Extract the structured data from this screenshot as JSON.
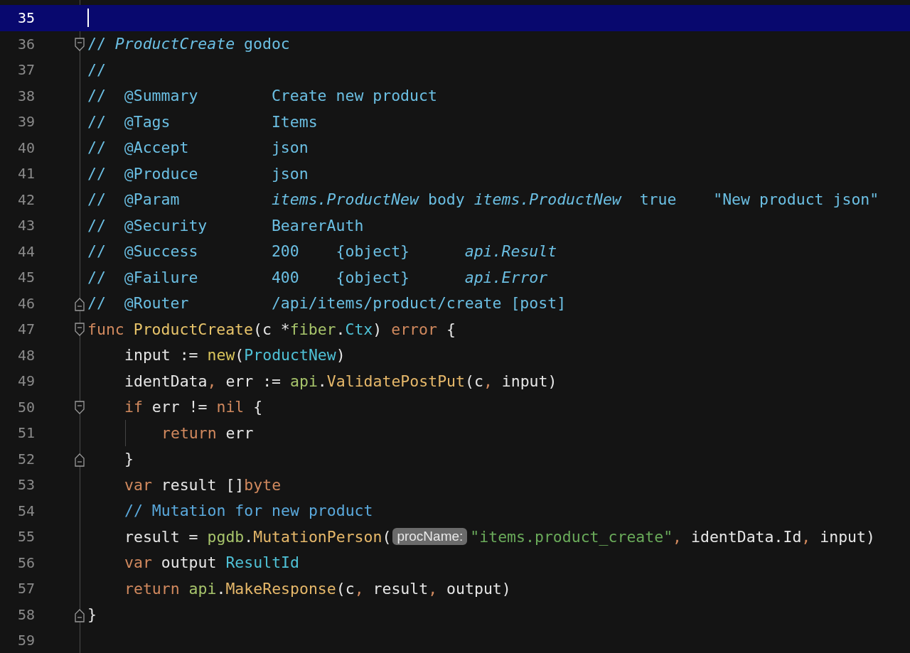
{
  "editor": {
    "lines": [
      {
        "number": "35",
        "selected": true
      },
      {
        "number": "36",
        "selected": false,
        "fold_start": true,
        "fold_end": false,
        "tokens": [
          {
            "text": "// ",
            "kind": "doc"
          },
          {
            "text": "ProductCreate",
            "kind": "doc_ref"
          },
          {
            "text": " godoc",
            "kind": "doc"
          }
        ]
      },
      {
        "number": "37",
        "selected": false,
        "tokens": [
          {
            "text": "//",
            "kind": "doc"
          }
        ]
      },
      {
        "number": "38",
        "selected": false,
        "tokens": [
          {
            "text": "//  @Summary        Create new product",
            "kind": "doc"
          }
        ]
      },
      {
        "number": "39",
        "selected": false,
        "tokens": [
          {
            "text": "//  @Tags           Items",
            "kind": "doc"
          }
        ]
      },
      {
        "number": "40",
        "selected": false,
        "tokens": [
          {
            "text": "//  @Accept         json",
            "kind": "doc"
          }
        ]
      },
      {
        "number": "41",
        "selected": false,
        "tokens": [
          {
            "text": "//  @Produce        json",
            "kind": "doc"
          }
        ]
      },
      {
        "number": "42",
        "selected": false,
        "tokens": [
          {
            "text": "//  @Param          ",
            "kind": "doc"
          },
          {
            "text": "items.ProductNew",
            "kind": "doc_ref"
          },
          {
            "text": " body ",
            "kind": "doc"
          },
          {
            "text": "items.ProductNew",
            "kind": "doc_ref"
          },
          {
            "text": "  true    \"New product json\"",
            "kind": "doc"
          }
        ]
      },
      {
        "number": "43",
        "selected": false,
        "tokens": [
          {
            "text": "//  @Security       BearerAuth",
            "kind": "doc"
          }
        ]
      },
      {
        "number": "44",
        "selected": false,
        "tokens": [
          {
            "text": "//  @Success        200    {object}      ",
            "kind": "doc"
          },
          {
            "text": "api.Result",
            "kind": "doc_ref"
          }
        ]
      },
      {
        "number": "45",
        "selected": false,
        "tokens": [
          {
            "text": "//  @Failure        400    {object}      ",
            "kind": "doc"
          },
          {
            "text": "api.Error",
            "kind": "doc_ref"
          }
        ]
      },
      {
        "number": "46",
        "selected": false,
        "fold_start": false,
        "fold_end": true,
        "tokens": [
          {
            "text": "//  @Router         /api/items/product/create [post]",
            "kind": "doc"
          }
        ]
      },
      {
        "number": "47",
        "selected": false,
        "fold_start": true,
        "fold_end": false,
        "tokens": [
          {
            "text": "func ",
            "kind": "keyword"
          },
          {
            "text": "ProductCreate",
            "kind": "function"
          },
          {
            "text": "(c *",
            "kind": "plain"
          },
          {
            "text": "fiber",
            "kind": "package"
          },
          {
            "text": ".",
            "kind": "plain"
          },
          {
            "text": "Ctx",
            "kind": "type"
          },
          {
            "text": ") ",
            "kind": "plain"
          },
          {
            "text": "error",
            "kind": "keyword"
          },
          {
            "text": " {",
            "kind": "plain"
          }
        ],
        "children": [
          {
            "number": "48",
            "selected": false,
            "tokens": [
              {
                "text": "input := ",
                "kind": "plain"
              },
              {
                "text": "new",
                "kind": "builtin"
              },
              {
                "text": "(",
                "kind": "plain"
              },
              {
                "text": "ProductNew",
                "kind": "type"
              },
              {
                "text": ")",
                "kind": "plain"
              }
            ]
          },
          {
            "number": "49",
            "selected": false,
            "tokens": [
              {
                "text": "identData",
                "kind": "plain"
              },
              {
                "text": ",",
                "kind": "keyword"
              },
              {
                "text": " err := ",
                "kind": "plain"
              },
              {
                "text": "api",
                "kind": "package"
              },
              {
                "text": ".",
                "kind": "plain"
              },
              {
                "text": "ValidatePostPut",
                "kind": "call"
              },
              {
                "text": "(c",
                "kind": "plain"
              },
              {
                "text": ",",
                "kind": "keyword"
              },
              {
                "text": " input)",
                "kind": "plain"
              }
            ]
          },
          {
            "number": "50",
            "selected": false,
            "fold_start": true,
            "fold_end": false,
            "tokens": [
              {
                "text": "if",
                "kind": "keyword"
              },
              {
                "text": " err != ",
                "kind": "plain"
              },
              {
                "text": "nil",
                "kind": "keyword"
              },
              {
                "text": " {",
                "kind": "plain"
              }
            ],
            "children": [
              {
                "number": "51",
                "selected": false,
                "tokens": [
                  {
                    "text": "return",
                    "kind": "keyword"
                  },
                  {
                    "text": " err",
                    "kind": "plain"
                  }
                ]
              }
            ]
          },
          {
            "number": "52",
            "selected": false,
            "fold_start": false,
            "fold_end": true,
            "tokens": [
              {
                "text": "}",
                "kind": "plain"
              }
            ]
          },
          {
            "number": "53",
            "selected": false,
            "tokens": [
              {
                "text": "var",
                "kind": "keyword"
              },
              {
                "text": " result []",
                "kind": "plain"
              },
              {
                "text": "byte",
                "kind": "keyword"
              }
            ]
          },
          {
            "number": "54",
            "selected": false,
            "tokens": [
              {
                "text": "// Mutation for new product",
                "kind": "comment"
              }
            ]
          },
          {
            "number": "55",
            "selected": false,
            "tokens": [
              {
                "text": "result = ",
                "kind": "plain"
              },
              {
                "text": "pgdb",
                "kind": "package"
              },
              {
                "text": ".",
                "kind": "plain"
              },
              {
                "text": "MutationPerson",
                "kind": "call"
              },
              {
                "text": "(",
                "kind": "plain"
              },
              {
                "text": "procName:",
                "kind": "hint"
              },
              {
                "text": "\"items.product_create\"",
                "kind": "string"
              },
              {
                "text": ",",
                "kind": "keyword"
              },
              {
                "text": " identData.Id",
                "kind": "plain"
              },
              {
                "text": ",",
                "kind": "keyword"
              },
              {
                "text": " input)",
                "kind": "plain"
              }
            ]
          },
          {
            "number": "56",
            "selected": false,
            "tokens": [
              {
                "text": "var",
                "kind": "keyword"
              },
              {
                "text": " output ",
                "kind": "plain"
              },
              {
                "text": "ResultId",
                "kind": "type"
              }
            ]
          },
          {
            "number": "57",
            "selected": false,
            "tokens": [
              {
                "text": "return ",
                "kind": "keyword"
              },
              {
                "text": "api",
                "kind": "package"
              },
              {
                "text": ".",
                "kind": "plain"
              },
              {
                "text": "MakeResponse",
                "kind": "call"
              },
              {
                "text": "(c",
                "kind": "plain"
              },
              {
                "text": ",",
                "kind": "keyword"
              },
              {
                "text": " result",
                "kind": "plain"
              },
              {
                "text": ",",
                "kind": "keyword"
              },
              {
                "text": " output)",
                "kind": "plain"
              }
            ]
          }
        ]
      },
      {
        "number": "58",
        "selected": false,
        "fold_start": false,
        "fold_end": true,
        "tokens": [
          {
            "text": "}",
            "kind": "plain"
          }
        ]
      },
      {
        "number": "59",
        "selected": false
      }
    ]
  }
}
